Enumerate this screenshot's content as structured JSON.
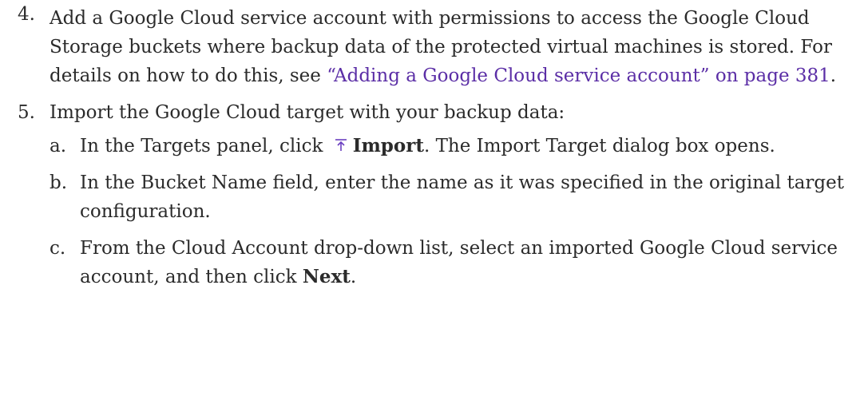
{
  "steps": {
    "step4": {
      "number": "4.",
      "text_before_link": "Add a Google Cloud service account with permissions to access the Google Cloud Storage buckets where backup data of the protected virtual machines is stored. For details on how to do this, see ",
      "link_text": "“Adding a Google Cloud service account” on page 381",
      "text_after_link": "."
    },
    "step5": {
      "number": "5.",
      "text": "Import the Google Cloud target with your backup data:",
      "substeps": {
        "a": {
          "letter": "a.",
          "text_before": "In the Targets panel, click ",
          "bold": "Import",
          "text_after": ". The Import Target dialog box opens."
        },
        "b": {
          "letter": "b.",
          "text": "In the Bucket Name field, enter the name as it was specified in the original target configuration."
        },
        "c": {
          "letter": "c.",
          "text_before": "From the Cloud Account drop-down list, select an imported Google Cloud service account, and then click ",
          "bold": "Next",
          "text_after": "."
        }
      }
    }
  },
  "icons": {
    "import": "import-icon"
  },
  "colors": {
    "link": "#5b2ea6",
    "icon": "#6a3fc0",
    "text": "#2b2b2b"
  }
}
